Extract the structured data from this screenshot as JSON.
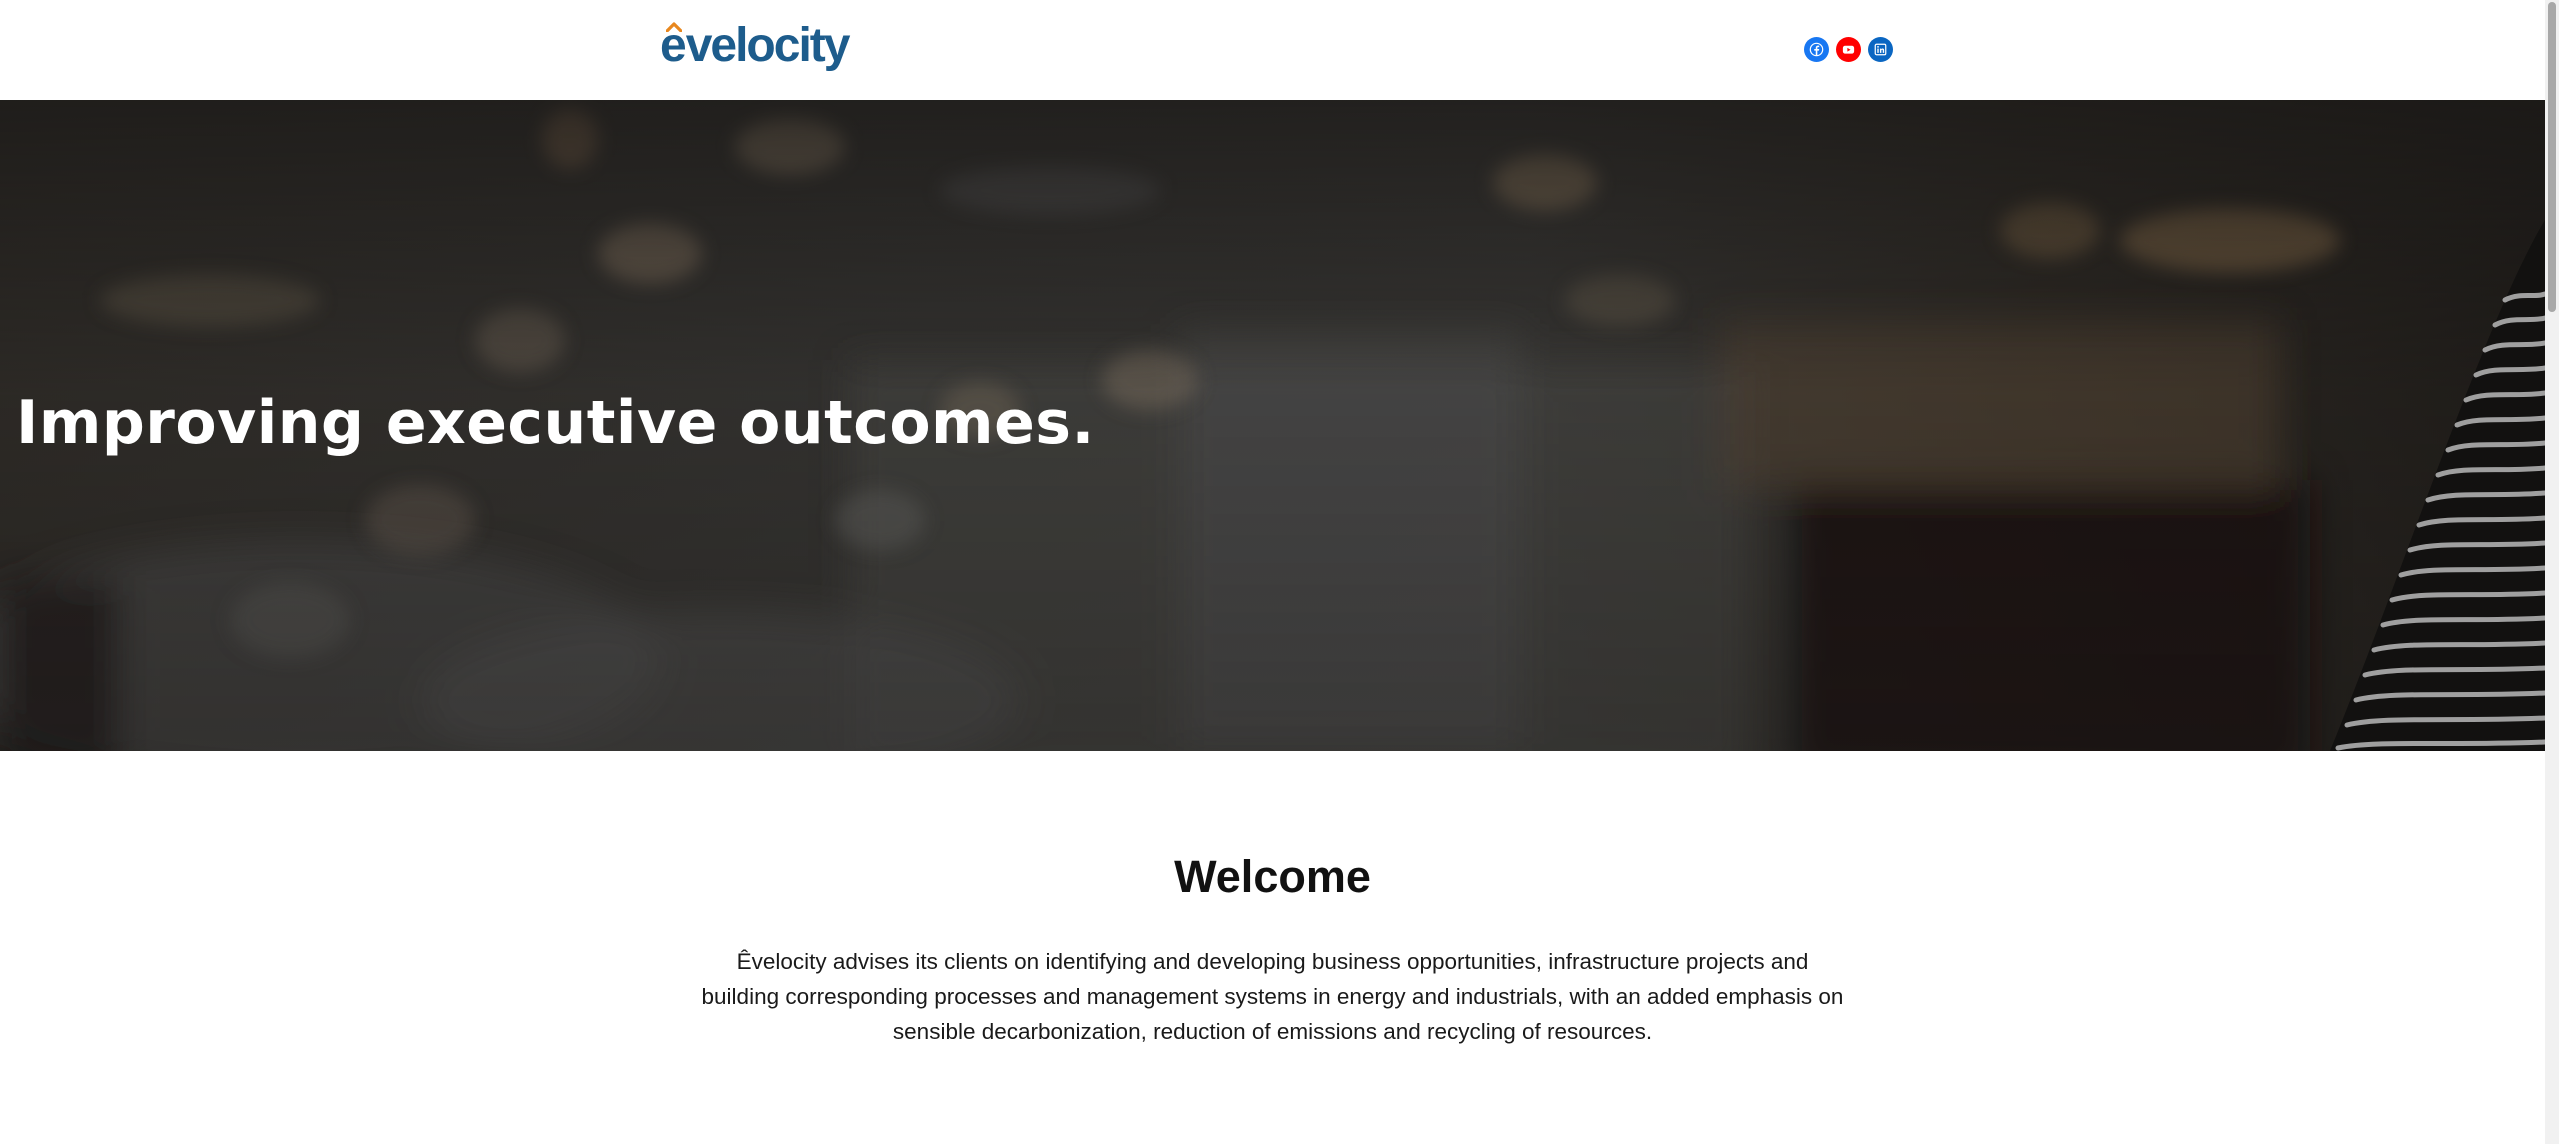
{
  "header": {
    "logo_text": "êvelocity",
    "social": [
      {
        "name": "facebook-icon",
        "color": "#1877f2"
      },
      {
        "name": "youtube-icon",
        "color": "#ff0000"
      },
      {
        "name": "linkedin-icon",
        "color": "#0a66c2"
      }
    ]
  },
  "hero": {
    "title": "Improving executive outcomes."
  },
  "welcome": {
    "heading": "Welcome",
    "body": "Êvelocity advises its clients on identifying and developing business opportunities, infrastructure projects and building corresponding processes and management systems in energy and industrials, with an added emphasis on sensible decarbonization, reduction of emissions and recycling of resources."
  },
  "colors": {
    "brand_blue": "#1d5c8c",
    "brand_orange": "#e8871e"
  }
}
